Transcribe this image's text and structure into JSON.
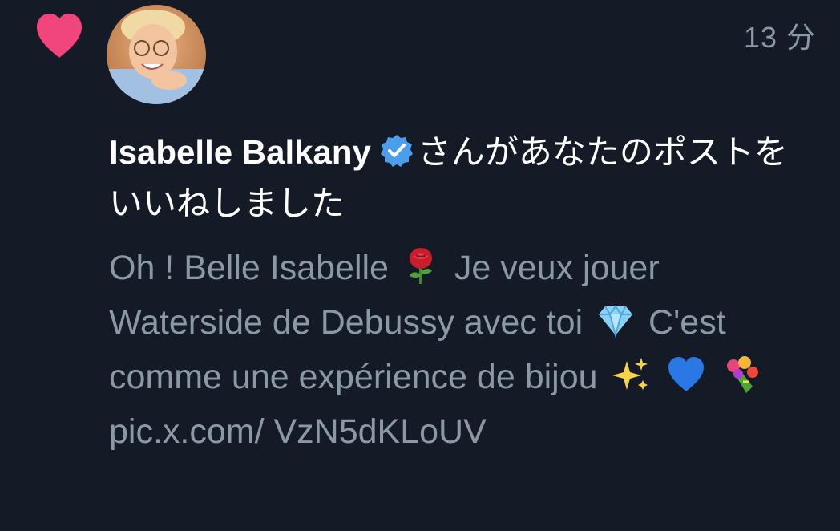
{
  "notification": {
    "type_icon": "heart-icon",
    "type_color": "#f0467d",
    "timestamp": "13 分",
    "user": {
      "name": "Isabelle Balkany",
      "verified": true,
      "badge_icon": "verified-badge-icon",
      "badge_color": "#4d9ded"
    },
    "action_text": "さんがあなたのポストをいいねしました",
    "post": {
      "seg1": "Oh ! Belle Isabelle",
      "emoji1": "rose-emoji",
      "seg2": "Je veux jouer Waterside de Debussy avec toi",
      "emoji2": "gem-emoji",
      "seg3": "C'est comme une expérience de bijou",
      "emoji3": "sparkles-emoji",
      "emoji4": "blue-heart-emoji",
      "emoji5": "bouquet-emoji",
      "link": "pic.x.com/ VzN5dKLoUV"
    }
  },
  "colors": {
    "background": "#141b26",
    "primary_text": "#ffffff",
    "secondary_text": "#8b98a5"
  }
}
